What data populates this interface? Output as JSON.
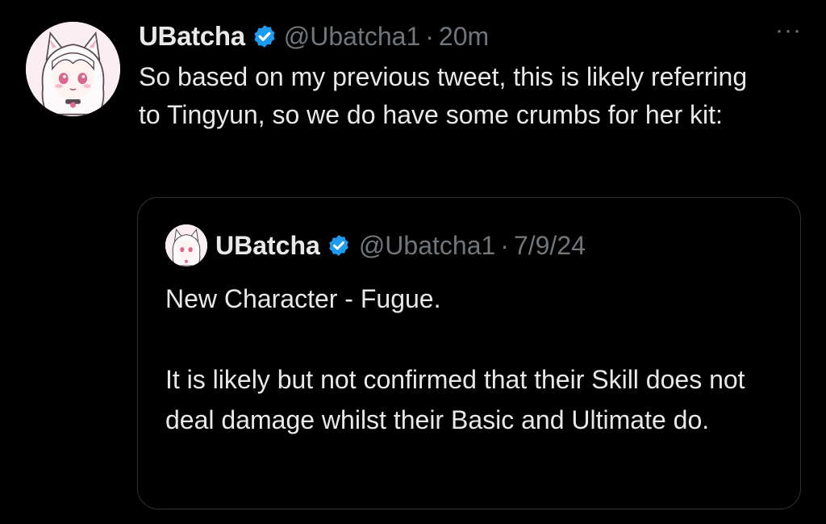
{
  "tweet": {
    "author_name": "UBatcha",
    "handle": "@Ubatcha1",
    "separator": "·",
    "time": "20m",
    "more_label": "···",
    "text": "So based on my previous tweet, this is likely referring to Tingyun, so we do have some crumbs for her kit:",
    "avatar_icon": "anime-avatar-icon",
    "verified_icon": "verified-badge-icon"
  },
  "quoted_tweet": {
    "author_name": "UBatcha",
    "handle": "@Ubatcha1",
    "separator": "·",
    "date": "7/9/24",
    "paragraph_1": "New Character - Fugue.",
    "paragraph_2": "It is likely but not confirmed that their Skill does not deal damage whilst their Basic and Ultimate do."
  },
  "colors": {
    "background": "#000000",
    "text_primary": "#e7e9ea",
    "text_secondary": "#71767b",
    "verified": "#1d9bf0",
    "border": "#2f3336"
  }
}
